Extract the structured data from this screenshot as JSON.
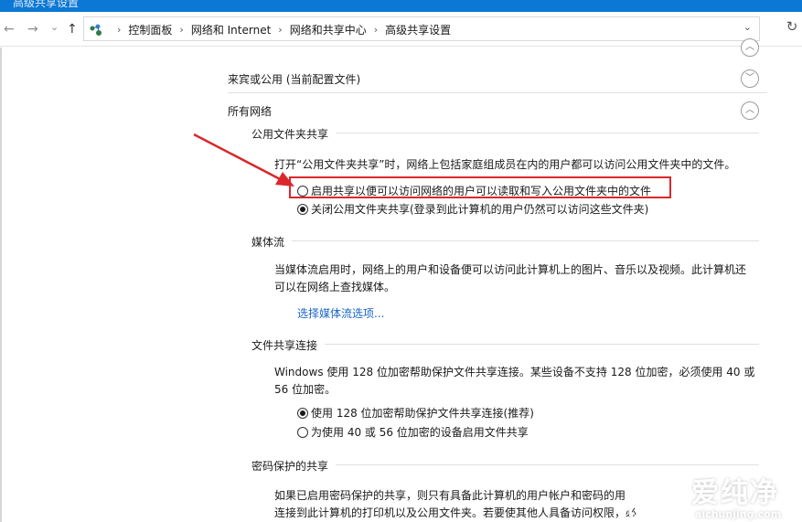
{
  "window": {
    "title": "高级共享设置"
  },
  "nav": {
    "back": "←",
    "forward": "→",
    "history": "⌄",
    "up": "↑",
    "breadcrumbs": [
      "控制面板",
      "网络和 Internet",
      "网络和共享中心",
      "高级共享设置"
    ],
    "separator": "›",
    "dropdown": "⌄",
    "refresh": "↻"
  },
  "profiles": {
    "guest": {
      "label": "来宾或公用 (当前配置文件)",
      "expanded": false
    },
    "all": {
      "label": "所有网络",
      "expanded": true
    }
  },
  "public_folder": {
    "heading": "公用文件夹共享",
    "description": "打开“公用文件夹共享”时，网络上包括家庭组成员在内的用户都可以访问公用文件夹中的文件。",
    "options": [
      {
        "label": "启用共享以便可以访问网络的用户可以读取和写入公用文件夹中的文件",
        "selected": false
      },
      {
        "label": "关闭公用文件夹共享(登录到此计算机的用户仍然可以访问这些文件夹)",
        "selected": true
      }
    ]
  },
  "media": {
    "heading": "媒体流",
    "description": "当媒体流启用时，网络上的用户和设备便可以访问此计算机上的图片、音乐以及视频。此计算机还可以在网络上查找媒体。",
    "link": "选择媒体流选项..."
  },
  "file_sharing": {
    "heading": "文件共享连接",
    "description": "Windows 使用 128 位加密帮助保护文件共享连接。某些设备不支持 128 位加密，必须使用 40 或 56 位加密。",
    "options": [
      {
        "label": "使用 128 位加密帮助保护文件共享连接(推荐)",
        "selected": true
      },
      {
        "label": "为使用 40 或 56 位加密的设备启用文件共享",
        "selected": false
      }
    ]
  },
  "password": {
    "heading": "密码保护的共享",
    "line1": "如果已启用密码保护的共享，则只有具备此计算机的用户帐户和密码的用",
    "line2": "连接到此计算机的打印机以及公用文件夹。若要使其他人具备访问权限，必"
  },
  "annotation": {
    "color": "#d9282b"
  },
  "watermark": {
    "title": "爱纯净",
    "url": "aichunjing.com"
  }
}
